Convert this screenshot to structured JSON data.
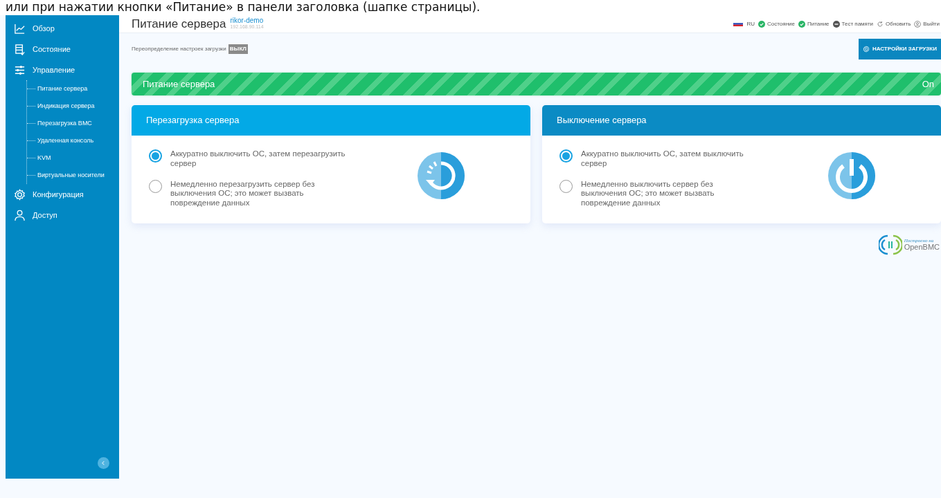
{
  "caption": "или при нажатии кнопки «Питание» в панели заголовка (шапке страницы).",
  "sidebar": {
    "items": [
      {
        "label": "Обзор",
        "kind": "chart"
      },
      {
        "label": "Состояние",
        "kind": "list"
      },
      {
        "label": "Управление",
        "kind": "sliders",
        "children": [
          {
            "label": "Питание сервера"
          },
          {
            "label": "Индикация сервера"
          },
          {
            "label": "Перезагрузка BMC"
          },
          {
            "label": "Удаленная консоль"
          },
          {
            "label": "KVM"
          },
          {
            "label": "Виртуальные носители"
          }
        ]
      },
      {
        "label": "Конфигурация",
        "kind": "gear"
      },
      {
        "label": "Доступ",
        "kind": "user"
      }
    ]
  },
  "header": {
    "title": "Питание сервера",
    "host": "rikor-demo",
    "ip": "192.168.90.114",
    "status": [
      {
        "kind": "flag",
        "label": "RU"
      },
      {
        "kind": "ok",
        "label": "Состояние"
      },
      {
        "kind": "ok",
        "label": "Питание"
      },
      {
        "kind": "off",
        "label": "Тест памяти"
      },
      {
        "kind": "refresh",
        "label": "Обновить"
      },
      {
        "kind": "user",
        "label": "Выйти"
      }
    ]
  },
  "boot_override": {
    "label": "Переопределение настроек загрузки",
    "badge": "ВЫКЛ"
  },
  "settings_button": "НАСТРОЙКИ ЗАГРУЗКИ",
  "power_bar": {
    "label": "Питание сервера",
    "value": "On"
  },
  "cards": [
    {
      "title": "Перезагрузка сервера",
      "color": "#03a9e6",
      "kind": "reboot",
      "options": [
        {
          "label": "Аккуратно выключить ОС, затем перезагрузить сервер",
          "selected": true
        },
        {
          "label": "Немедленно перезагрузить сервер без выключения ОС; это может вызвать повреждение данных",
          "selected": false
        }
      ]
    },
    {
      "title": "Выключение сервера",
      "color": "#0b8bc4",
      "kind": "power",
      "options": [
        {
          "label": "Аккуратно выключить ОС, затем выключить сервер",
          "selected": true
        },
        {
          "label": "Немедленно выключить сервер без выключения ОС; это может вызвать повреждение данных",
          "selected": false
        }
      ]
    }
  ],
  "footer": {
    "built_on": "Построено на",
    "brand": "OpenBMC"
  }
}
